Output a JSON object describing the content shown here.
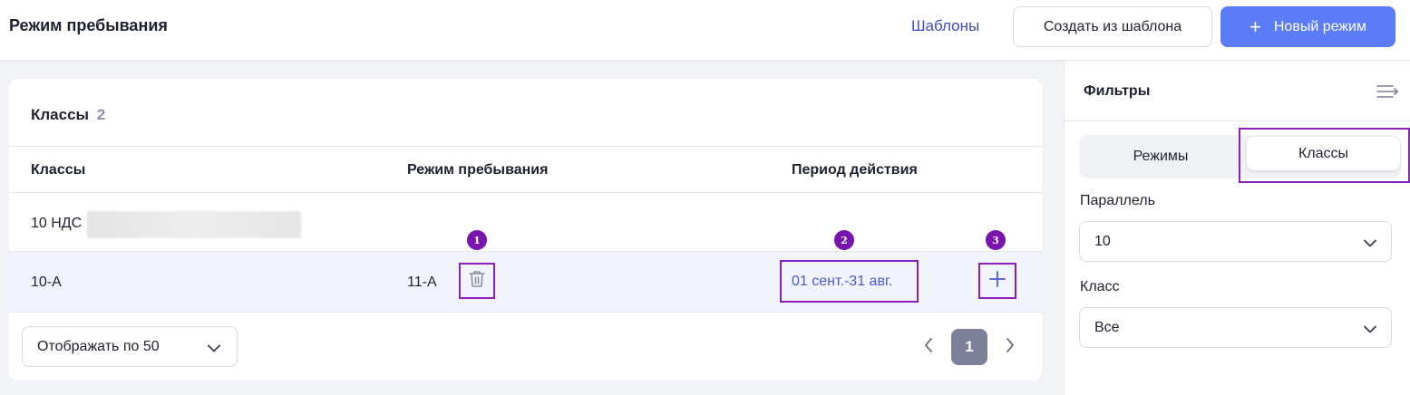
{
  "header": {
    "title": "Режим пребывания",
    "templates_link": "Шаблоны",
    "create_from_template_label": "Создать из шаблона",
    "new_mode_label": "Новый режим"
  },
  "table": {
    "title": "Классы",
    "count": "2",
    "columns": [
      "Классы",
      "Режим пребывания",
      "Период действия"
    ],
    "rows": [
      {
        "class": "10 НДС",
        "mode": "",
        "period": ""
      },
      {
        "class": "10-А",
        "mode": "11-А",
        "period": "01 сент.-31 авг."
      }
    ],
    "markers": [
      "1",
      "2",
      "3"
    ]
  },
  "pagination": {
    "per_page_label": "Отображать по 50",
    "current_page": "1"
  },
  "filters": {
    "title": "Фильтры",
    "tabs": [
      "Режимы",
      "Классы"
    ],
    "active_tab": "Классы",
    "parallel_label": "Параллель",
    "parallel_value": "10",
    "class_label": "Класс",
    "class_value": "Все"
  },
  "colors": {
    "accent": "#5b7cf8",
    "link": "#4a58d6",
    "highlight_row": "#f2f4fd",
    "annotation": "#8a1fc0"
  },
  "icons": [
    "plus-icon",
    "trash-icon",
    "chevron-down-icon",
    "chevron-left-icon",
    "chevron-right-icon",
    "collapse-filters-icon"
  ]
}
